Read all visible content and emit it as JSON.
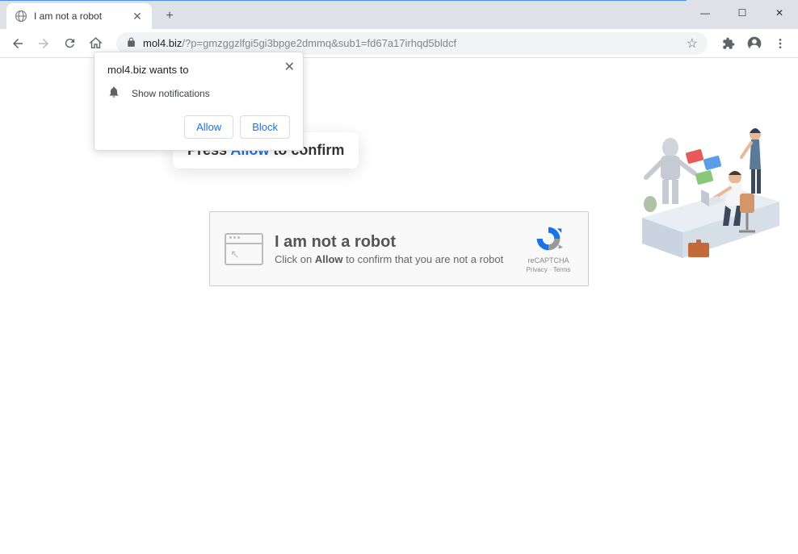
{
  "window": {
    "minimize": "—",
    "maximize": "☐",
    "close": "✕"
  },
  "tab": {
    "title": "I am not a robot",
    "close": "✕"
  },
  "toolbar": {
    "url_domain": "mol4.biz",
    "url_path": "/?p=gmzggzlfgi5gi3bpge2dmmq&sub1=fd67a17irhqd5bldcf"
  },
  "permission": {
    "title": "mol4.biz wants to",
    "item_label": "Show notifications",
    "allow_label": "Allow",
    "block_label": "Block",
    "close": "✕"
  },
  "prompt": {
    "pre": "Press ",
    "highlight": "Allow",
    "post": " to confirm"
  },
  "captcha": {
    "title": "I am not a robot",
    "sub_pre": "Click on ",
    "sub_bold": "Allow",
    "sub_post": " to confirm that you are not a robot",
    "badge_label": "reCAPTCHA",
    "badge_links": "Privacy · Terms"
  }
}
